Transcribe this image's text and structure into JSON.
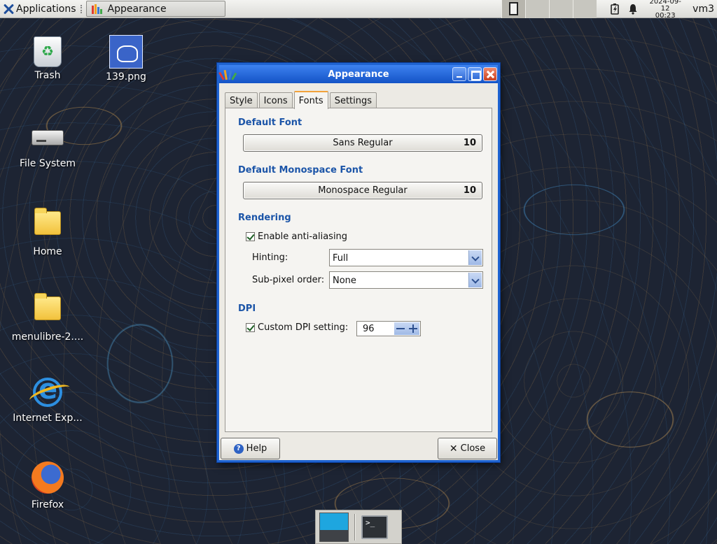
{
  "top_panel": {
    "apps_label": "Applications",
    "task_title": "Appearance",
    "clock_date": "2024-09-12",
    "clock_time": "00:23",
    "user": "vm3"
  },
  "desktop": {
    "icons": [
      {
        "label": "Trash",
        "icon": "trash-icon"
      },
      {
        "label": "139.png",
        "icon": "image-file-icon"
      },
      {
        "label": "File System",
        "icon": "drive-icon"
      },
      {
        "label": "Home",
        "icon": "folder-icon"
      },
      {
        "label": "menulibre-2....",
        "icon": "folder-icon"
      },
      {
        "label": "Internet Exp...",
        "icon": "internet-explorer-icon"
      },
      {
        "label": "Firefox",
        "icon": "firefox-icon"
      }
    ]
  },
  "dialog": {
    "title": "Appearance",
    "tabs": [
      {
        "label": "Style",
        "active": false
      },
      {
        "label": "Icons",
        "active": false
      },
      {
        "label": "Fonts",
        "active": true
      },
      {
        "label": "Settings",
        "active": false
      }
    ],
    "default_font": {
      "heading": "Default Font",
      "name": "Sans Regular",
      "size": "10"
    },
    "mono_font": {
      "heading": "Default Monospace Font",
      "name": "Monospace Regular",
      "size": "10"
    },
    "rendering": {
      "heading": "Rendering",
      "antialias_label": "Enable anti-aliasing",
      "antialias_checked": true,
      "hinting_label": "Hinting:",
      "hinting_value": "Full",
      "subpixel_label": "Sub-pixel order:",
      "subpixel_value": "None"
    },
    "dpi": {
      "heading": "DPI",
      "custom_label": "Custom DPI setting:",
      "custom_checked": true,
      "value": "96"
    },
    "help_label": "Help",
    "close_label": "Close"
  },
  "colors": {
    "titlebar": "#1f63d0",
    "section_heading": "#1c55a8",
    "active_tab_accent": "#f2a23a"
  }
}
